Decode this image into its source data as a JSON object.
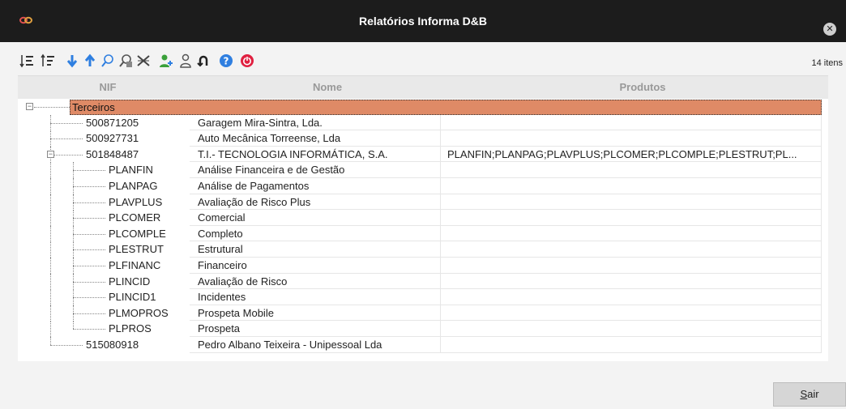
{
  "window": {
    "title": "Relatórios Informa D&B"
  },
  "toolbar": {
    "count_label": "14 itens"
  },
  "table": {
    "headers": [
      "NIF",
      "Nome",
      "Produtos"
    ],
    "group_label": "Terceiros",
    "rows": [
      {
        "nif": "500871205",
        "nome": "Garagem Mira-Sintra, Lda.",
        "produtos": ""
      },
      {
        "nif": "500927731",
        "nome": "Auto Mecânica Torreense, Lda",
        "produtos": ""
      },
      {
        "nif": "501848487",
        "nome": "T.I.- TECNOLOGIA INFORMÁTICA, S.A.",
        "produtos": "PLANFIN;PLANPAG;PLAVPLUS;PLCOMER;PLCOMPLE;PLESTRUT;PL..."
      },
      {
        "nif": "PLANFIN",
        "nome": "Análise Financeira e de Gestão",
        "produtos": ""
      },
      {
        "nif": "PLANPAG",
        "nome": "Análise de Pagamentos",
        "produtos": ""
      },
      {
        "nif": "PLAVPLUS",
        "nome": "Avaliação de Risco Plus",
        "produtos": ""
      },
      {
        "nif": "PLCOMER",
        "nome": "Comercial",
        "produtos": ""
      },
      {
        "nif": "PLCOMPLE",
        "nome": "Completo",
        "produtos": ""
      },
      {
        "nif": "PLESTRUT",
        "nome": "Estrutural",
        "produtos": ""
      },
      {
        "nif": "PLFINANC",
        "nome": "Financeiro",
        "produtos": ""
      },
      {
        "nif": "PLINCID",
        "nome": "Avaliação de Risco",
        "produtos": ""
      },
      {
        "nif": "PLINCID1",
        "nome": "Incidentes",
        "produtos": ""
      },
      {
        "nif": "PLMOPROS",
        "nome": "Prospeta Mobile",
        "produtos": ""
      },
      {
        "nif": "PLPROS",
        "nome": "Prospeta",
        "produtos": ""
      },
      {
        "nif": "515080918",
        "nome": "Pedro Albano Teixeira - Unipessoal Lda",
        "produtos": ""
      }
    ]
  },
  "footer": {
    "exit_label": "Sair"
  },
  "colors": {
    "titlebar": "#1c1c1c",
    "group_highlight": "#df8a66",
    "accent_blue": "#2f7fe0",
    "accent_red": "#e02040",
    "accent_green": "#3aa03a"
  }
}
